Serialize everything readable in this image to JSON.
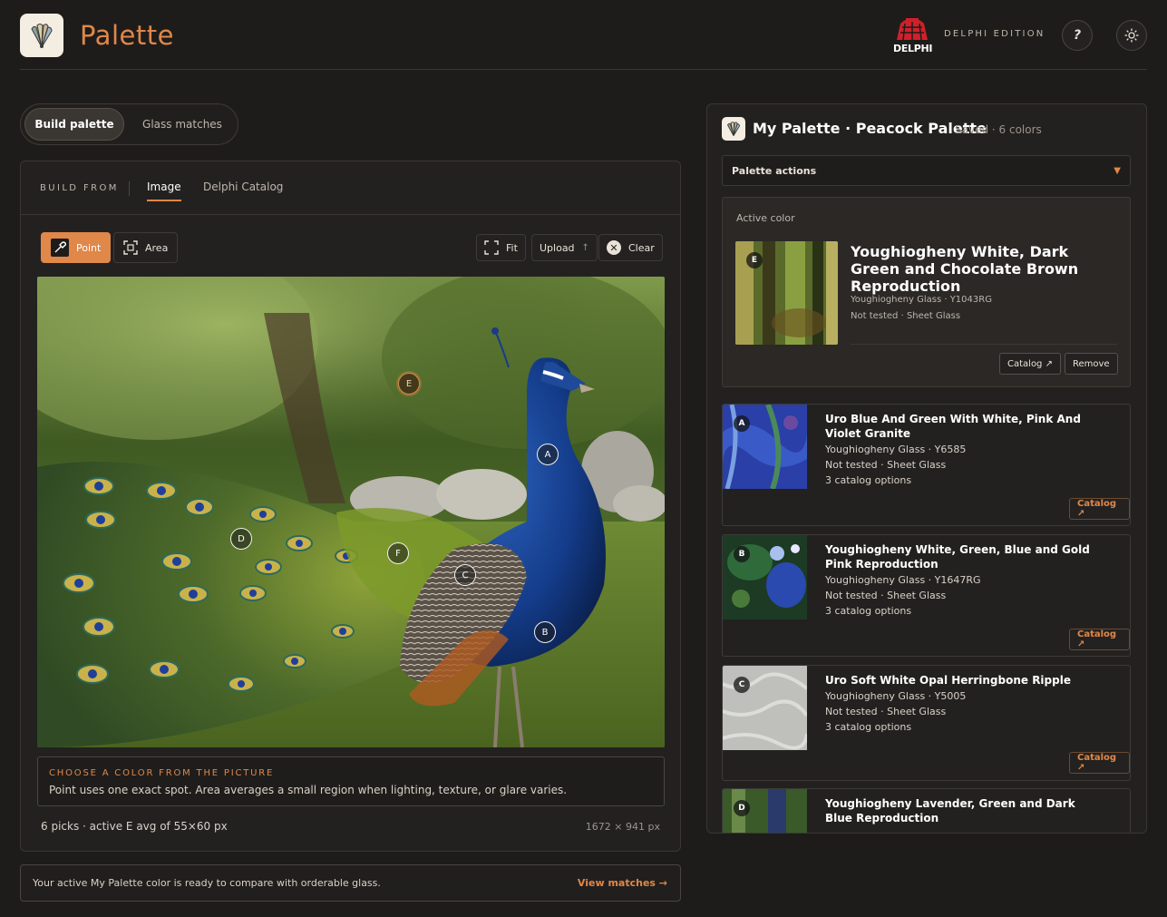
{
  "header": {
    "app_title": "Palette",
    "brand_name": "DELPHI",
    "edition": "DELPHI EDITION",
    "help_label": "?",
    "accent_color": "#e0874a"
  },
  "tabs": {
    "build": "Build palette",
    "matches": "Glass matches"
  },
  "builder": {
    "build_from": "BUILD FROM",
    "source_tabs": [
      "Image",
      "Delphi Catalog"
    ],
    "tools": {
      "point": "Point",
      "area": "Area",
      "fit": "Fit",
      "upload": "Upload",
      "clear": "Clear"
    },
    "markers": [
      "A",
      "B",
      "C",
      "D",
      "E",
      "F"
    ],
    "active_marker": "E",
    "hint_title": "CHOOSE A COLOR FROM THE PICTURE",
    "hint_body": "Point uses one exact spot. Area averages a small region when lighting, texture, or glare varies.",
    "picks_status": "6 picks · active E avg of 55×60 px",
    "image_dims": "1672 × 941 px"
  },
  "bottom": {
    "message": "Your active My Palette color is ready to compare with orderable glass.",
    "link": "View matches →"
  },
  "palette": {
    "title": "My Palette · Peacock Palette",
    "meta": "Saved · 6 colors",
    "actions_label": "Palette actions",
    "active": {
      "label": "Active color",
      "letter": "E",
      "name": "Youghiogheny White, Dark Green and Chocolate Brown Reproduction",
      "line1": "Youghiogheny Glass · Y1043RG",
      "line2": "Not tested · Sheet Glass",
      "catalog_btn": "Catalog ↗",
      "remove_btn": "Remove"
    },
    "colors": [
      {
        "letter": "A",
        "name": "Uro Blue And Green With White, Pink And Violet Granite",
        "maker": "Youghiogheny Glass · Y6585",
        "status": "Not tested · Sheet Glass",
        "options": "3 catalog options",
        "btn": "Catalog ↗"
      },
      {
        "letter": "B",
        "name": "Youghiogheny White, Green, Blue and Gold Pink Reproduction",
        "maker": "Youghiogheny Glass · Y1647RG",
        "status": "Not tested · Sheet Glass",
        "options": "3 catalog options",
        "btn": "Catalog ↗"
      },
      {
        "letter": "C",
        "name": "Uro Soft White Opal Herringbone Ripple",
        "maker": "Youghiogheny Glass · Y5005",
        "status": "Not tested · Sheet Glass",
        "options": "3 catalog options",
        "btn": "Catalog ↗"
      },
      {
        "letter": "D",
        "name": "Youghiogheny Lavender, Green and Dark Blue Reproduction"
      }
    ]
  }
}
